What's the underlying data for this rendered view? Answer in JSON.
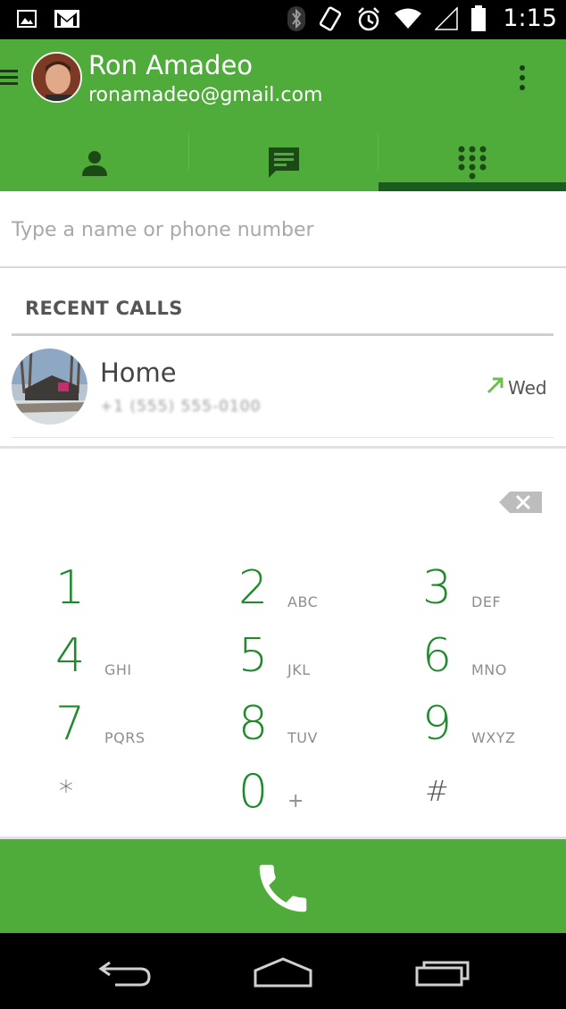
{
  "status_bar": {
    "time": "1:15",
    "icons": [
      "gallery-notification-icon",
      "gmail-notification-icon",
      "bluetooth-icon",
      "vibrate-icon",
      "alarm-icon",
      "wifi-icon",
      "signal-icon",
      "battery-icon"
    ]
  },
  "header": {
    "account_name": "Ron Amadeo",
    "account_email": "ronamadeo@gmail.com",
    "tabs": [
      {
        "icon": "contacts-icon"
      },
      {
        "icon": "messages-icon"
      },
      {
        "icon": "dialpad-icon"
      }
    ],
    "active_tab": 2
  },
  "search": {
    "placeholder": "Type a name or phone number",
    "value": ""
  },
  "recent_calls": {
    "title": "RECENT CALLS",
    "items": [
      {
        "name": "Home",
        "number": "+1 (555) 555-0100",
        "date": "Wed",
        "call_type": "outgoing"
      }
    ]
  },
  "dialpad": {
    "keys": [
      {
        "digit": "1",
        "letters": ""
      },
      {
        "digit": "2",
        "letters": "ABC"
      },
      {
        "digit": "3",
        "letters": "DEF"
      },
      {
        "digit": "4",
        "letters": "GHI"
      },
      {
        "digit": "5",
        "letters": "JKL"
      },
      {
        "digit": "6",
        "letters": "MNO"
      },
      {
        "digit": "7",
        "letters": "PQRS"
      },
      {
        "digit": "8",
        "letters": "TUV"
      },
      {
        "digit": "9",
        "letters": "WXYZ"
      },
      {
        "digit": "*",
        "letters": ""
      },
      {
        "digit": "0",
        "letters": "+"
      },
      {
        "digit": "#",
        "letters": ""
      }
    ]
  },
  "colors": {
    "accent": "#4fac3b",
    "accent_dark": "#1a5c1d",
    "digit": "#1f8a2b",
    "outgoing_call": "#6cc04a"
  },
  "nav": [
    "back-icon",
    "home-icon",
    "recents-icon"
  ]
}
